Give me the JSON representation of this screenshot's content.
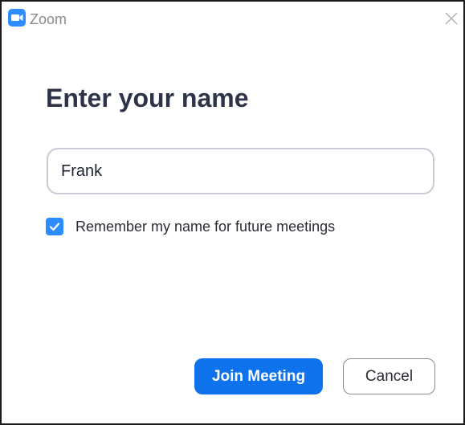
{
  "window": {
    "title": "Zoom",
    "app_icon": "zoom-video-camera-icon",
    "close_icon": "close-icon"
  },
  "dialog": {
    "heading": "Enter your name",
    "name_input": {
      "value": "Frank",
      "placeholder": ""
    },
    "remember": {
      "label": "Remember my name for future meetings",
      "checked": true,
      "icon": "checkmark-icon"
    },
    "buttons": {
      "join_label": "Join Meeting",
      "cancel_label": "Cancel"
    }
  },
  "colors": {
    "accent": "#0E72ED",
    "checkbox": "#2D8CFF",
    "heading": "#2E3348",
    "title_text": "#8A8A8A"
  }
}
